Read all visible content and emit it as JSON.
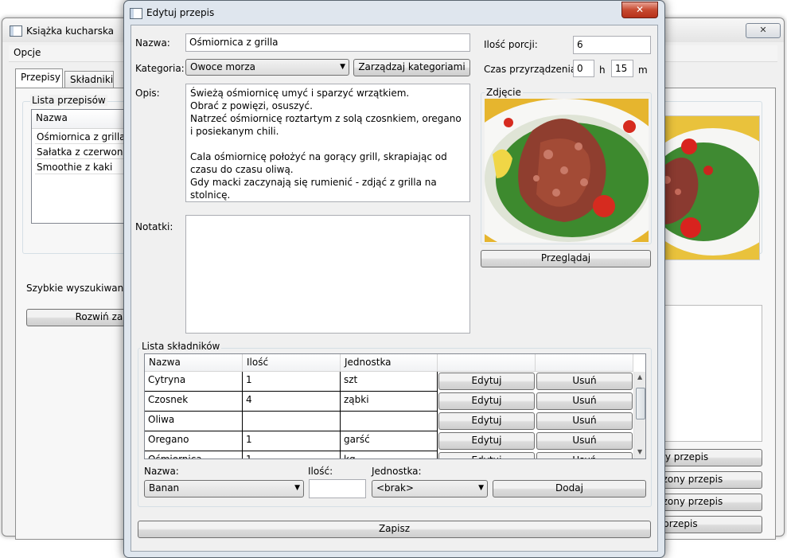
{
  "main_window": {
    "title": "Książka kucharska",
    "close_symbol": "✕",
    "menu": [
      "Opcje"
    ],
    "tabs": [
      {
        "label": "Przepisy",
        "active": true
      },
      {
        "label": "Składniki",
        "active": false
      }
    ],
    "recipes_group_label": "Lista przepisów",
    "recipes_column": "Nazwa",
    "recipes": [
      "Ośmiornica z grilla",
      "Sałatka z czerwoną c",
      "Smoothie z kaki"
    ],
    "quick_search_label": "Szybkie wyszukiwanie:",
    "expand_button": "Rozwiń zaaw",
    "right_buttons": [
      "wy przepis",
      "czony przepis",
      "czony przepis",
      "l przepis"
    ]
  },
  "dialog": {
    "title": "Edytuj przepis",
    "close_symbol": "✕",
    "name_label": "Nazwa:",
    "name_value": "Ośmiornica z grilla",
    "category_label": "Kategoria:",
    "category_value": "Owoce morza",
    "manage_categories_button": "Zarządzaj kategoriami",
    "servings_label": "Ilość porcji:",
    "servings_value": "6",
    "prep_time_label": "Czas przyrządzenia:",
    "prep_hours": "0",
    "hours_unit": "h",
    "prep_minutes": "15",
    "minutes_unit": "m",
    "description_label": "Opis:",
    "description_value": "Świeżą ośmiornicę umyć i sparzyć wrzątkiem.\nObrać z powięzi, osuszyć.\nNatrzeć ośmiornicę roztartym z solą czosnkiem, oregano i posiekanym chili.\n\nCala ośmiornicę położyć na gorący grill, skrapiając od czasu do czasu oliwą.\nGdy macki zaczynają się rumienić - zdjąć z grilla na stolnicę.",
    "notes_label": "Notatki:",
    "notes_value": "",
    "photo_label": "Zdjęcie",
    "browse_button": "Przeglądaj",
    "ingredients_group_label": "Lista składników",
    "ingredients_columns": [
      "Nazwa",
      "Ilość",
      "Jednostka",
      "",
      ""
    ],
    "ingredients": [
      {
        "name": "Cytryna",
        "qty": "1",
        "unit": "szt",
        "edit": "Edytuj",
        "delete": "Usuń"
      },
      {
        "name": "Czosnek",
        "qty": "4",
        "unit": "ząbki",
        "edit": "Edytuj",
        "delete": "Usuń"
      },
      {
        "name": "Oliwa",
        "qty": "",
        "unit": "",
        "edit": "Edytuj",
        "delete": "Usuń"
      },
      {
        "name": "Oregano",
        "qty": "1",
        "unit": "garść",
        "edit": "Edytuj",
        "delete": "Usuń"
      },
      {
        "name": "Ośmiornica",
        "qty": "1",
        "unit": "kg",
        "edit": "Edytuj",
        "delete": "Usuń"
      }
    ],
    "add_name_label": "Nazwa:",
    "add_name_value": "Banan",
    "add_qty_label": "Ilość:",
    "add_qty_value": "",
    "add_unit_label": "Jednostka:",
    "add_unit_value": "<brak>",
    "add_button": "Dodaj",
    "save_button": "Zapisz"
  }
}
